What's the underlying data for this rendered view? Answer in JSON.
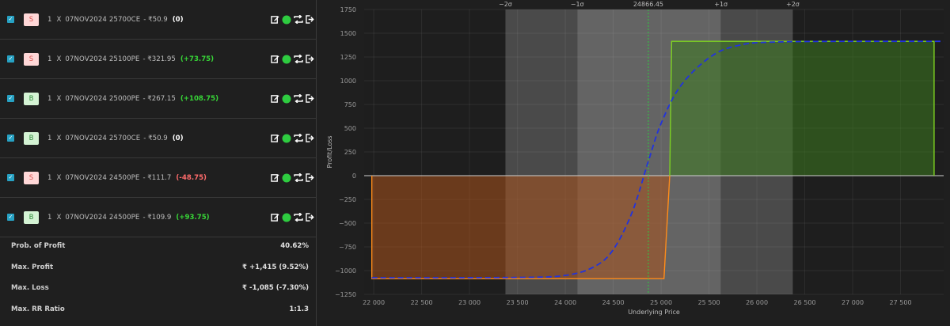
{
  "legs": [
    {
      "side": "S",
      "qty": "1",
      "x": "X",
      "contract": "07NOV2024 25700CE",
      "price": "- ₹50.9",
      "pnl": "(0)",
      "pnl_type": "zero"
    },
    {
      "side": "S",
      "qty": "1",
      "x": "X",
      "contract": "07NOV2024 25100PE",
      "price": "- ₹321.95",
      "pnl": "(+73.75)",
      "pnl_type": "pos"
    },
    {
      "side": "B",
      "qty": "1",
      "x": "X",
      "contract": "07NOV2024 25000PE",
      "price": "- ₹267.15",
      "pnl": "(+108.75)",
      "pnl_type": "pos"
    },
    {
      "side": "B",
      "qty": "1",
      "x": "X",
      "contract": "07NOV2024 25700CE",
      "price": "- ₹50.9",
      "pnl": "(0)",
      "pnl_type": "zero"
    },
    {
      "side": "S",
      "qty": "1",
      "x": "X",
      "contract": "07NOV2024 24500PE",
      "price": "- ₹111.7",
      "pnl": "(-48.75)",
      "pnl_type": "neg"
    },
    {
      "side": "B",
      "qty": "1",
      "x": "X",
      "contract": "07NOV2024 24500PE",
      "price": "- ₹109.9",
      "pnl": "(+93.75)",
      "pnl_type": "pos"
    }
  ],
  "stats": {
    "prob_profit_label": "Prob. of Profit",
    "prob_profit_value": "40.62%",
    "max_profit_label": "Max. Profit",
    "max_profit_value": "₹ +1,415 (9.52%)",
    "max_loss_label": "Max. Loss",
    "max_loss_value": "₹ -1,085 (-7.30%)",
    "rr_label": "Max. RR Ratio",
    "rr_value": "1:1.3"
  },
  "colors": {
    "sell_badge_bg": "#ffd7d7",
    "buy_badge_bg": "#d4f3d4",
    "profit_green": "#37d537",
    "loss_red": "#ff6b6b",
    "profit_area": "#2e5a1c",
    "loss_area": "#6a3516",
    "expiry_line_green": "#7ed321",
    "expiry_line_orange": "#ff8c1a",
    "today_curve_blue": "#2233dd"
  },
  "chart_data": {
    "type": "line",
    "xlabel": "Underlying Price",
    "ylabel": "Profit/Loss",
    "xlim": [
      21900,
      27950
    ],
    "ylim": [
      -1250,
      1750
    ],
    "x_ticks": [
      "22 000",
      "22 500",
      "23 000",
      "23 500",
      "24 000",
      "24 500",
      "25 000",
      "25 500",
      "26 000",
      "26 500",
      "27 000",
      "27 500"
    ],
    "y_ticks": [
      "1750",
      "1500",
      "1250",
      "1000",
      "750",
      "500",
      "250",
      "0",
      "−250",
      "−500",
      "−750",
      "−1000",
      "−1250"
    ],
    "spot_label": "24866.45",
    "spot": 24866.45,
    "sigma_bands": [
      {
        "label": "−2σ",
        "x": 23375
      },
      {
        "label": "−1σ",
        "x": 24125
      },
      {
        "label": "+1σ",
        "x": 25625
      },
      {
        "label": "+2σ",
        "x": 26375
      }
    ],
    "series": [
      {
        "points": [
          [
            21900,
            -1085
          ],
          [
            25000,
            -1085
          ],
          [
            25100,
            1415
          ],
          [
            27950,
            1415
          ]
        ]
      },
      {
        "points": [
          [
            21900,
            -1075
          ],
          [
            23500,
            -1072
          ],
          [
            24000,
            -1050
          ],
          [
            24300,
            -960
          ],
          [
            24500,
            -780
          ],
          [
            24700,
            -380
          ],
          [
            24866,
            150
          ],
          [
            25000,
            550
          ],
          [
            25200,
            940
          ],
          [
            25500,
            1240
          ],
          [
            25800,
            1370
          ],
          [
            26300,
            1410
          ],
          [
            27950,
            1415
          ]
        ]
      }
    ]
  }
}
